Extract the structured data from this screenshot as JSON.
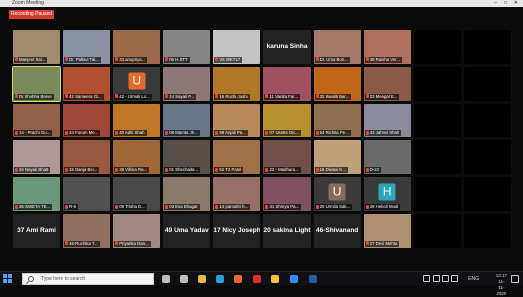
{
  "window": {
    "title": "Zoom Meeting"
  },
  "recording_label": "Recording Paused",
  "participants": [
    {
      "name": "Manjeet Sal...",
      "bg": "#a08a70",
      "av": null
    },
    {
      "name": "Dr. Pallavi Tal...",
      "bg": "#8a92a4",
      "av": null
    },
    {
      "name": "33.anupriya...",
      "bg": "#9c6a48",
      "av": null
    },
    {
      "name": "06 H.STT",
      "bg": "#868686",
      "av": null
    },
    {
      "name": "V5 WKT17",
      "bg": "#c4c4c4",
      "av": null
    },
    {
      "name": "",
      "bg": "#222",
      "av": null,
      "big": "karuna Sinha"
    },
    {
      "name": "Dr. Uma Bori...",
      "bg": "#a47868",
      "av": null
    },
    {
      "name": "48 Raisha Ver...",
      "bg": "#b07060",
      "av": null
    },
    {
      "name": "",
      "bg": "#000",
      "av": null
    },
    {
      "name": "",
      "bg": "#000",
      "av": null
    },
    {
      "name": "Dr.Shobha Barve",
      "bg": "#7a8a5a",
      "av": null,
      "highlight": true
    },
    {
      "name": "42 Sameera Gi...",
      "bg": "#b05030",
      "av": null
    },
    {
      "name": "42 - Urmali Lo...",
      "bg": "#3a3a3a",
      "av": "U",
      "av_color": "#e86a2a"
    },
    {
      "name": "14 Sayali P...",
      "bg": "#907878",
      "av": null
    },
    {
      "name": "16 Ruchi Joshi",
      "bg": "#b07828",
      "av": null
    },
    {
      "name": "11 Vanita Far...",
      "bg": "#a05060",
      "av": null
    },
    {
      "name": "32 Swaliti Bar...",
      "bg": "#c06818",
      "av": null
    },
    {
      "name": "23 Meegal E...",
      "bg": "#8a5a48",
      "av": null
    },
    {
      "name": "",
      "bg": "#000",
      "av": null
    },
    {
      "name": "",
      "bg": "#000",
      "av": null
    },
    {
      "name": "14 - Prachi Gu...",
      "bg": "#906048",
      "av": null
    },
    {
      "name": "24 Forum Me...",
      "bg": "#a04838",
      "av": null
    },
    {
      "name": "40 Aditi Shah",
      "bg": "#c07828",
      "av": null
    },
    {
      "name": "08 Mamta Jh...",
      "bg": "#687888",
      "av": null
    },
    {
      "name": "49 Anjali Pa...",
      "bg": "#b88858",
      "av": null
    },
    {
      "name": "07 Usette Dic...",
      "bg": "#b89030",
      "av": null
    },
    {
      "name": "54 Richita Pe...",
      "bg": "#907050",
      "av": null
    },
    {
      "name": "43 Jahnvi Shah",
      "bg": "#8a8a9a",
      "av": null
    },
    {
      "name": "",
      "bg": "#000",
      "av": null
    },
    {
      "name": "",
      "bg": "#000",
      "av": null
    },
    {
      "name": "34 Nayak Bhatt",
      "bg": "#b09898",
      "av": null
    },
    {
      "name": "15 Danja Bei...",
      "bg": "#985840",
      "av": null
    },
    {
      "name": "38 Vihika Ra...",
      "bg": "#a06838",
      "av": null
    },
    {
      "name": "01 Shechaita...",
      "bg": "#585048",
      "av": null
    },
    {
      "name": "52 T2 Patel",
      "bg": "#a07048",
      "av": null
    },
    {
      "name": "22 - Madhura...",
      "bg": "#705048",
      "av": null
    },
    {
      "name": "18 Diwaxi K...",
      "bg": "#c0a078",
      "av": null
    },
    {
      "name": "D-22",
      "bg": "#6a6a6a",
      "av": null
    },
    {
      "name": "",
      "bg": "#000",
      "av": null
    },
    {
      "name": "",
      "bg": "#000",
      "av": null
    },
    {
      "name": "35-SWETA TE...",
      "bg": "#6a9878",
      "av": null
    },
    {
      "name": "R-6",
      "bg": "#505050",
      "av": null
    },
    {
      "name": "09 Trisha D...",
      "bg": "#484848",
      "av": null
    },
    {
      "name": "03 Eva Bhagat",
      "bg": "#8a7868",
      "av": null
    },
    {
      "name": "14 parnathi h...",
      "bg": "#987068",
      "av": null
    },
    {
      "name": "31 Shreya Pa...",
      "bg": "#805060",
      "av": null
    },
    {
      "name": "20 Urmila Sak...",
      "bg": "#3a3a3a",
      "av": "U",
      "av_color": "#8a6a5a"
    },
    {
      "name": "28 Heboli Modi",
      "bg": "#3a3a3a",
      "av": "H",
      "av_color": "#2aa8b8"
    },
    {
      "name": "",
      "bg": "#000",
      "av": null
    },
    {
      "name": "",
      "bg": "#000",
      "av": null
    },
    {
      "name": "",
      "bg": "#222",
      "av": null,
      "big": "37 Ami Rami"
    },
    {
      "name": "45-Ruchika T...",
      "bg": "#907060",
      "av": null
    },
    {
      "name": "Priyanka Dan...",
      "bg": "#a08880",
      "av": null
    },
    {
      "name": "",
      "bg": "#222",
      "av": null,
      "big": "49 Uma Yadav"
    },
    {
      "name": "",
      "bg": "#222",
      "av": null,
      "big": "17 Nicy Joseph"
    },
    {
      "name": "",
      "bg": "#222",
      "av": null,
      "big": "20 sakina Light..."
    },
    {
      "name": "",
      "bg": "#222",
      "av": null,
      "big": "46-Shivanand"
    },
    {
      "name": "27 Devi Mehta",
      "bg": "#b09070",
      "av": null
    },
    {
      "name": "",
      "bg": "#000",
      "av": null
    },
    {
      "name": "",
      "bg": "#000",
      "av": null
    }
  ],
  "taskbar": {
    "search_placeholder": "Type here to search",
    "lang": "ENG",
    "time": "13:17",
    "date": "11-11-2020",
    "icons": [
      {
        "name": "cortana-icon",
        "color": "#bdbdbd"
      },
      {
        "name": "task-view-icon",
        "color": "#bdbdbd"
      },
      {
        "name": "file-explorer-icon",
        "color": "#e8b84a"
      },
      {
        "name": "edge-icon",
        "color": "#2aa0d8"
      },
      {
        "name": "firefox-icon",
        "color": "#e86a2a"
      },
      {
        "name": "opera-icon",
        "color": "#d8302a"
      },
      {
        "name": "chrome-icon",
        "color": "#f2c23a"
      },
      {
        "name": "zoom-icon",
        "color": "#2d8cff"
      },
      {
        "name": "word-icon",
        "color": "#2a5aa8"
      }
    ]
  },
  "tray_icons": [
    {
      "name": "chevron-up-icon",
      "color": "#ccc"
    },
    {
      "name": "network-icon",
      "color": "#ccc"
    },
    {
      "name": "battery-icon",
      "color": "#ccc"
    },
    {
      "name": "volume-icon",
      "color": "#ccc"
    }
  ]
}
